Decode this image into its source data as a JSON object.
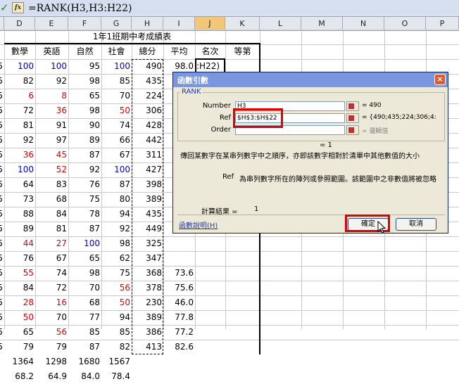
{
  "formula_bar": {
    "formula": "=RANK(H3,H3:H22)"
  },
  "columns": [
    "D",
    "E",
    "F",
    "G",
    "H",
    "I",
    "J",
    "K",
    "L",
    "M",
    "N",
    "O",
    "P"
  ],
  "selected_column": "J",
  "sheet": {
    "title": "1年1班期中考成績表",
    "headers": [
      "數學",
      "英語",
      "自然",
      "社會",
      "總分",
      "平均",
      "名次",
      "等第"
    ],
    "rows": [
      {
        "d": "100",
        "e": "100",
        "f": "95",
        "g": "100",
        "h": "490",
        "i": "98.0",
        "j": ":H22)",
        "dc": "blue",
        "ec": "blue",
        "fc": "",
        "gc": "blue"
      },
      {
        "d": "82",
        "e": "92",
        "f": "98",
        "g": "85",
        "h": "435",
        "i": "",
        "j": "",
        "dc": "",
        "ec": "",
        "fc": "",
        "gc": ""
      },
      {
        "d": "6",
        "e": "8",
        "f": "65",
        "g": "70",
        "h": "224",
        "i": "",
        "j": "",
        "dc": "red",
        "ec": "red",
        "fc": "",
        "gc": ""
      },
      {
        "d": "72",
        "e": "36",
        "f": "98",
        "g": "50",
        "h": "306",
        "i": "",
        "j": "",
        "dc": "",
        "ec": "red",
        "fc": "",
        "gc": "red"
      },
      {
        "d": "81",
        "e": "91",
        "f": "90",
        "g": "74",
        "h": "428",
        "i": "",
        "j": "",
        "dc": "",
        "ec": "",
        "fc": "",
        "gc": ""
      },
      {
        "d": "92",
        "e": "97",
        "f": "89",
        "g": "66",
        "h": "442",
        "i": "",
        "j": "",
        "dc": "",
        "ec": "",
        "fc": "",
        "gc": ""
      },
      {
        "d": "36",
        "e": "45",
        "f": "87",
        "g": "67",
        "h": "311",
        "i": "",
        "j": "",
        "dc": "red",
        "ec": "red",
        "fc": "",
        "gc": ""
      },
      {
        "d": "100",
        "e": "52",
        "f": "92",
        "g": "100",
        "h": "427",
        "i": "",
        "j": "",
        "dc": "blue",
        "ec": "red",
        "fc": "",
        "gc": "blue"
      },
      {
        "d": "64",
        "e": "83",
        "f": "76",
        "g": "87",
        "h": "398",
        "i": "",
        "j": "",
        "dc": "",
        "ec": "",
        "fc": "",
        "gc": ""
      },
      {
        "d": "73",
        "e": "68",
        "f": "75",
        "g": "80",
        "h": "389",
        "i": "",
        "j": "",
        "dc": "",
        "ec": "",
        "fc": "",
        "gc": ""
      },
      {
        "d": "88",
        "e": "84",
        "f": "78",
        "g": "94",
        "h": "435",
        "i": "",
        "j": "",
        "dc": "",
        "ec": "",
        "fc": "",
        "gc": ""
      },
      {
        "d": "89",
        "e": "81",
        "f": "87",
        "g": "92",
        "h": "449",
        "i": "",
        "j": "",
        "dc": "",
        "ec": "",
        "fc": "",
        "gc": ""
      },
      {
        "d": "44",
        "e": "27",
        "f": "100",
        "g": "98",
        "h": "325",
        "i": "",
        "j": "",
        "dc": "red",
        "ec": "red",
        "fc": "blue",
        "gc": ""
      },
      {
        "d": "76",
        "e": "67",
        "f": "65",
        "g": "62",
        "h": "347",
        "i": "",
        "j": "",
        "dc": "",
        "ec": "",
        "fc": "",
        "gc": ""
      },
      {
        "d": "55",
        "e": "74",
        "f": "98",
        "g": "75",
        "h": "368",
        "i": "73.6",
        "j": "",
        "dc": "red",
        "ec": "",
        "fc": "",
        "gc": ""
      },
      {
        "d": "84",
        "e": "72",
        "f": "70",
        "g": "56",
        "h": "378",
        "i": "75.6",
        "j": "",
        "dc": "",
        "ec": "",
        "fc": "",
        "gc": "red"
      },
      {
        "d": "28",
        "e": "16",
        "f": "68",
        "g": "50",
        "h": "230",
        "i": "46.0",
        "j": "",
        "dc": "red",
        "ec": "red",
        "fc": "",
        "gc": "red"
      },
      {
        "d": "50",
        "e": "70",
        "f": "77",
        "g": "94",
        "h": "389",
        "i": "77.8",
        "j": "",
        "dc": "red",
        "ec": "",
        "fc": "",
        "gc": ""
      },
      {
        "d": "65",
        "e": "56",
        "f": "85",
        "g": "85",
        "h": "386",
        "i": "77.2",
        "j": "",
        "dc": "",
        "ec": "red",
        "fc": "",
        "gc": ""
      },
      {
        "d": "79",
        "e": "79",
        "f": "87",
        "g": "82",
        "h": "413",
        "i": "82.6",
        "j": "",
        "dc": "",
        "ec": "",
        "fc": "",
        "gc": ""
      }
    ],
    "totals": {
      "d": "1364",
      "e": "1298",
      "f": "1680",
      "g": "1567"
    },
    "averages": {
      "d": "68.2",
      "e": "64.9",
      "f": "84.0",
      "g": "78.4"
    },
    "left_edge_digits": [
      "5",
      "5",
      "5",
      "5",
      "5",
      "5",
      "5",
      "5",
      "5",
      "5",
      "5",
      "5",
      "5",
      "5",
      "5",
      "5",
      "5",
      "5",
      "5",
      "5"
    ]
  },
  "dialog": {
    "title": "函數引數",
    "group_label": "RANK",
    "fields": [
      {
        "label": "Number",
        "value": "H3",
        "result": "= 490",
        "result_gray": false
      },
      {
        "label": "Ref",
        "value": "$H$3:$H$22",
        "result": "= {490;435;224;306;4:",
        "result_gray": false
      },
      {
        "label": "Order",
        "value": "",
        "result": "= 邏輯值",
        "result_gray": true
      }
    ],
    "result_line": "= 1",
    "description": "傳回某數字在某串列數字中之順序，亦即該數字相對於清單中其他數值的大小",
    "arg_name": "Ref",
    "arg_desc": "為串列數字所在的陣列或參照範圍。該範圍中之非數值將被忽略",
    "calc_label": "計算結果 =",
    "calc_value": "1",
    "help_link": "函數說明(H)",
    "ok": "確定",
    "cancel": "取消",
    "close_glyph": "×"
  },
  "accent": {
    "highlight": "#e00000",
    "title_bar": "#7a96df"
  }
}
